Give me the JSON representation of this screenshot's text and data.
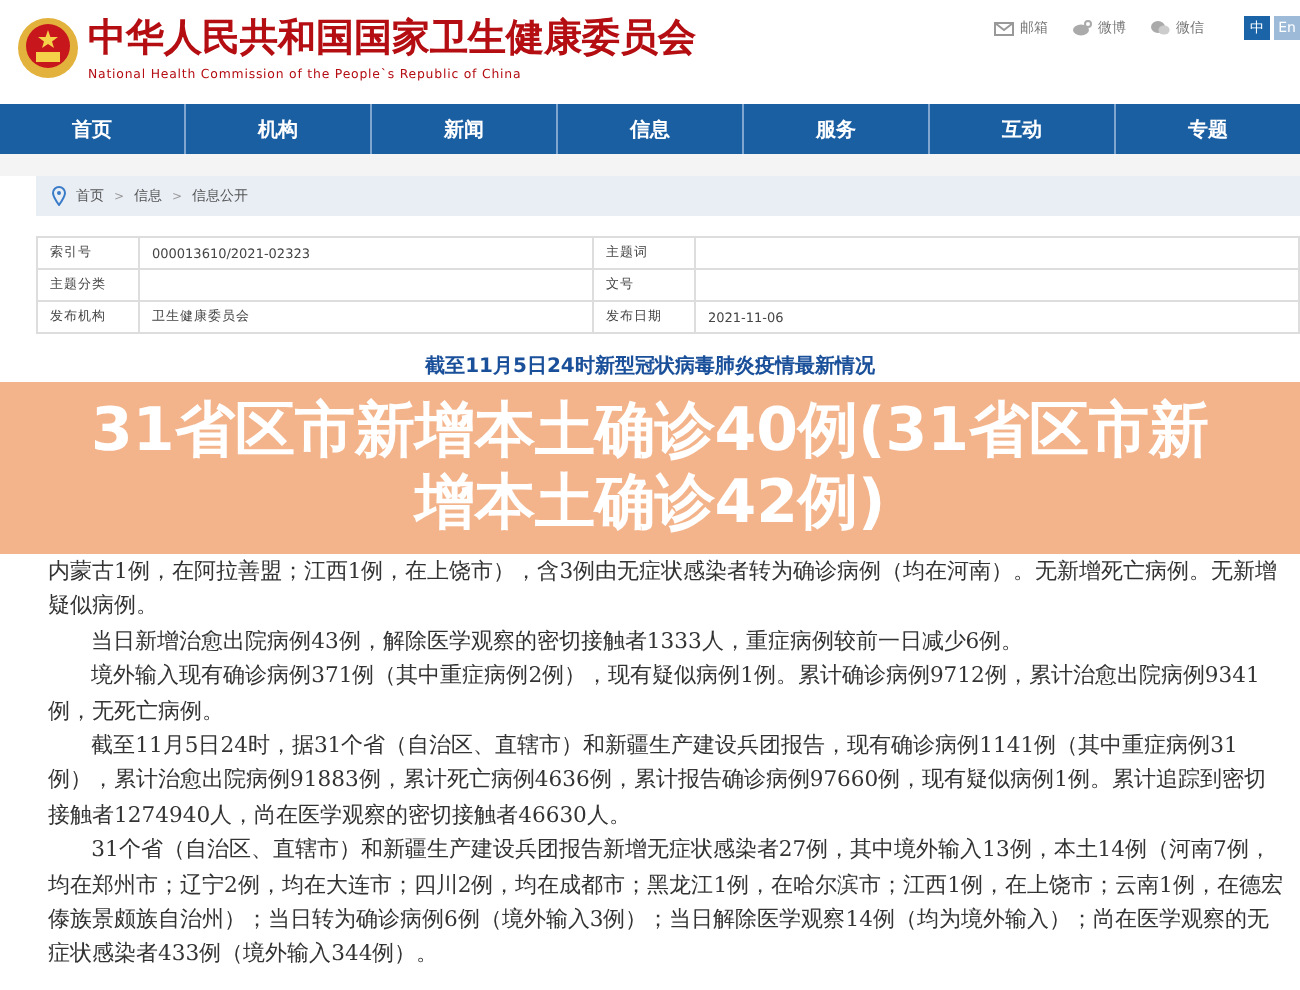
{
  "header": {
    "title": "中华人民共和国国家卫生健康委员会",
    "subtitle": "National Health Commission of the People`s Republic of China",
    "links": [
      {
        "kind": "mail",
        "label": "邮箱"
      },
      {
        "kind": "weibo",
        "label": "微博"
      },
      {
        "kind": "wechat",
        "label": "微信"
      }
    ],
    "languages": [
      {
        "label": "中",
        "selected": true
      },
      {
        "label": "En",
        "selected": false
      }
    ]
  },
  "nav": [
    "首页",
    "机构",
    "新闻",
    "信息",
    "服务",
    "互动",
    "专题"
  ],
  "breadcrumb": [
    {
      "kind": "link",
      "text": "首页"
    },
    {
      "kind": "separator",
      "text": ">"
    },
    {
      "kind": "link",
      "text": "信息"
    },
    {
      "kind": "separator",
      "text": ">"
    },
    {
      "kind": "link",
      "text": "信息公开"
    }
  ],
  "meta_table": [
    [
      {
        "label": "索引号",
        "value": "000013610/2021-02323"
      },
      {
        "label": "主题词"
      }
    ],
    [
      {
        "label": "主题分类"
      },
      {
        "label": "文号"
      }
    ],
    [
      {
        "label": "发布机构",
        "value": "卫生健康委员会"
      },
      {
        "label": "发布日期",
        "value": "2021-11-06"
      }
    ]
  ],
  "article_title": "截至11月5日24时新型冠状病毒肺炎疫情最新情况",
  "banner": "31省区市新增本土确诊40例(31省区市新增本土确诊42例)",
  "paragraphs": [
    {
      "indent": false,
      "text": "内蒙古1例，在阿拉善盟；江西1例，在上饶市），含3例由无症状感染者转为确诊病例（均在河南）。无新增死亡病例。无新增疑似病例。"
    },
    {
      "indent": true,
      "text": "当日新增治愈出院病例43例，解除医学观察的密切接触者1333人，重症病例较前一日减少6例。"
    },
    {
      "indent": true,
      "text": "境外输入现有确诊病例371例（其中重症病例2例），现有疑似病例1例。累计确诊病例9712例，累计治愈出院病例9341例，无死亡病例。"
    },
    {
      "indent": true,
      "text": "截至11月5日24时，据31个省（自治区、直辖市）和新疆生产建设兵团报告，现有确诊病例1141例（其中重症病例31例），累计治愈出院病例91883例，累计死亡病例4636例，累计报告确诊病例97660例，现有疑似病例1例。累计追踪到密切接触者1274940人，尚在医学观察的密切接触者46630人。"
    },
    {
      "indent": true,
      "text": "31个省（自治区、直辖市）和新疆生产建设兵团报告新增无症状感染者27例，其中境外输入13例，本土14例（河南7例，均在郑州市；辽宁2例，均在大连市；四川2例，均在成都市；黑龙江1例，在哈尔滨市；江西1例，在上饶市；云南1例，在德宏傣族景颇族自治州）；当日转为确诊病例6例（境外输入3例）；当日解除医学观察14例（均为境外输入）；尚在医学观察的无症状感染者433例（境外输入344例）。"
    }
  ]
}
